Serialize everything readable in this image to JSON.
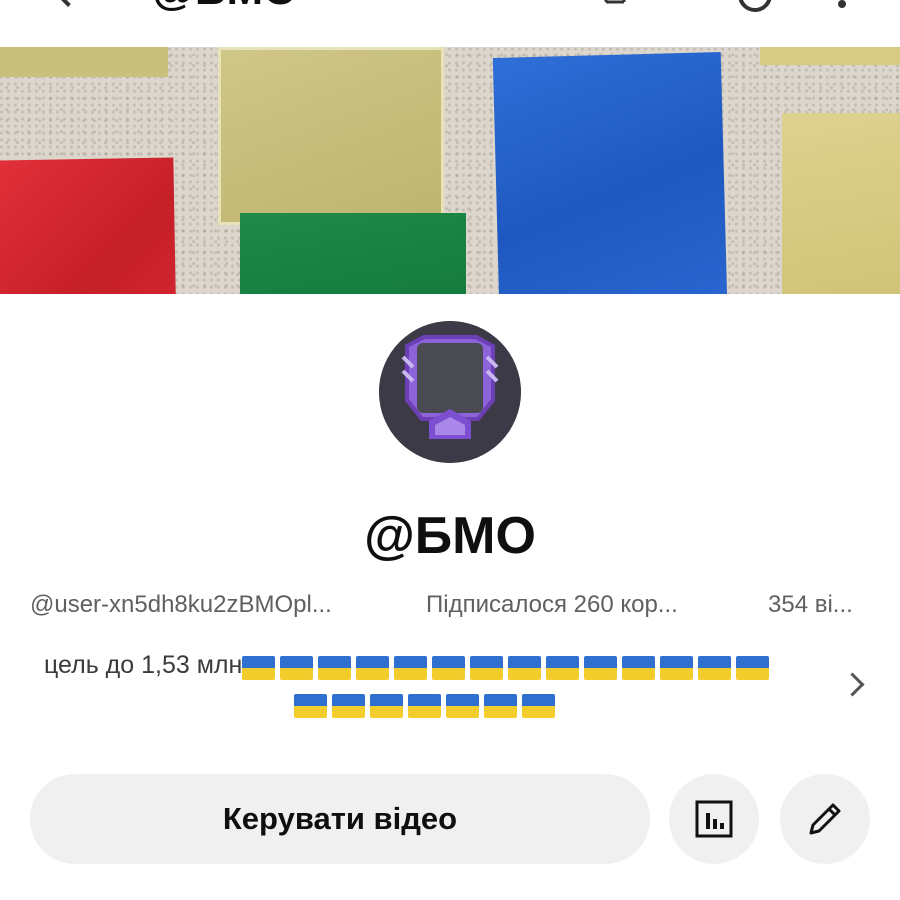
{
  "header": {
    "title": "@БМО"
  },
  "channel": {
    "name": "@БМО",
    "handle": "@user-xn5dh8ku2zBMOpl...",
    "subscribers": "Підписалося 260 кор...",
    "videos": "354 ві...",
    "description_text": "цель до 1,53 млн",
    "flags_line1_count": 14,
    "flags_line2_count": 7
  },
  "actions": {
    "manage_label": "Керувати відео"
  },
  "icons": {
    "back": "back-arrow-icon",
    "cast": "cast-icon",
    "search": "search-icon",
    "more": "more-vert-icon",
    "stats": "analytics-icon",
    "edit": "pencil-icon",
    "expand": "chevron-right-icon"
  },
  "colors": {
    "button_bg": "#f0f0f0",
    "secondary_text": "#606060",
    "flag_blue": "#2e6fd0",
    "flag_yellow": "#f3cd2c"
  }
}
